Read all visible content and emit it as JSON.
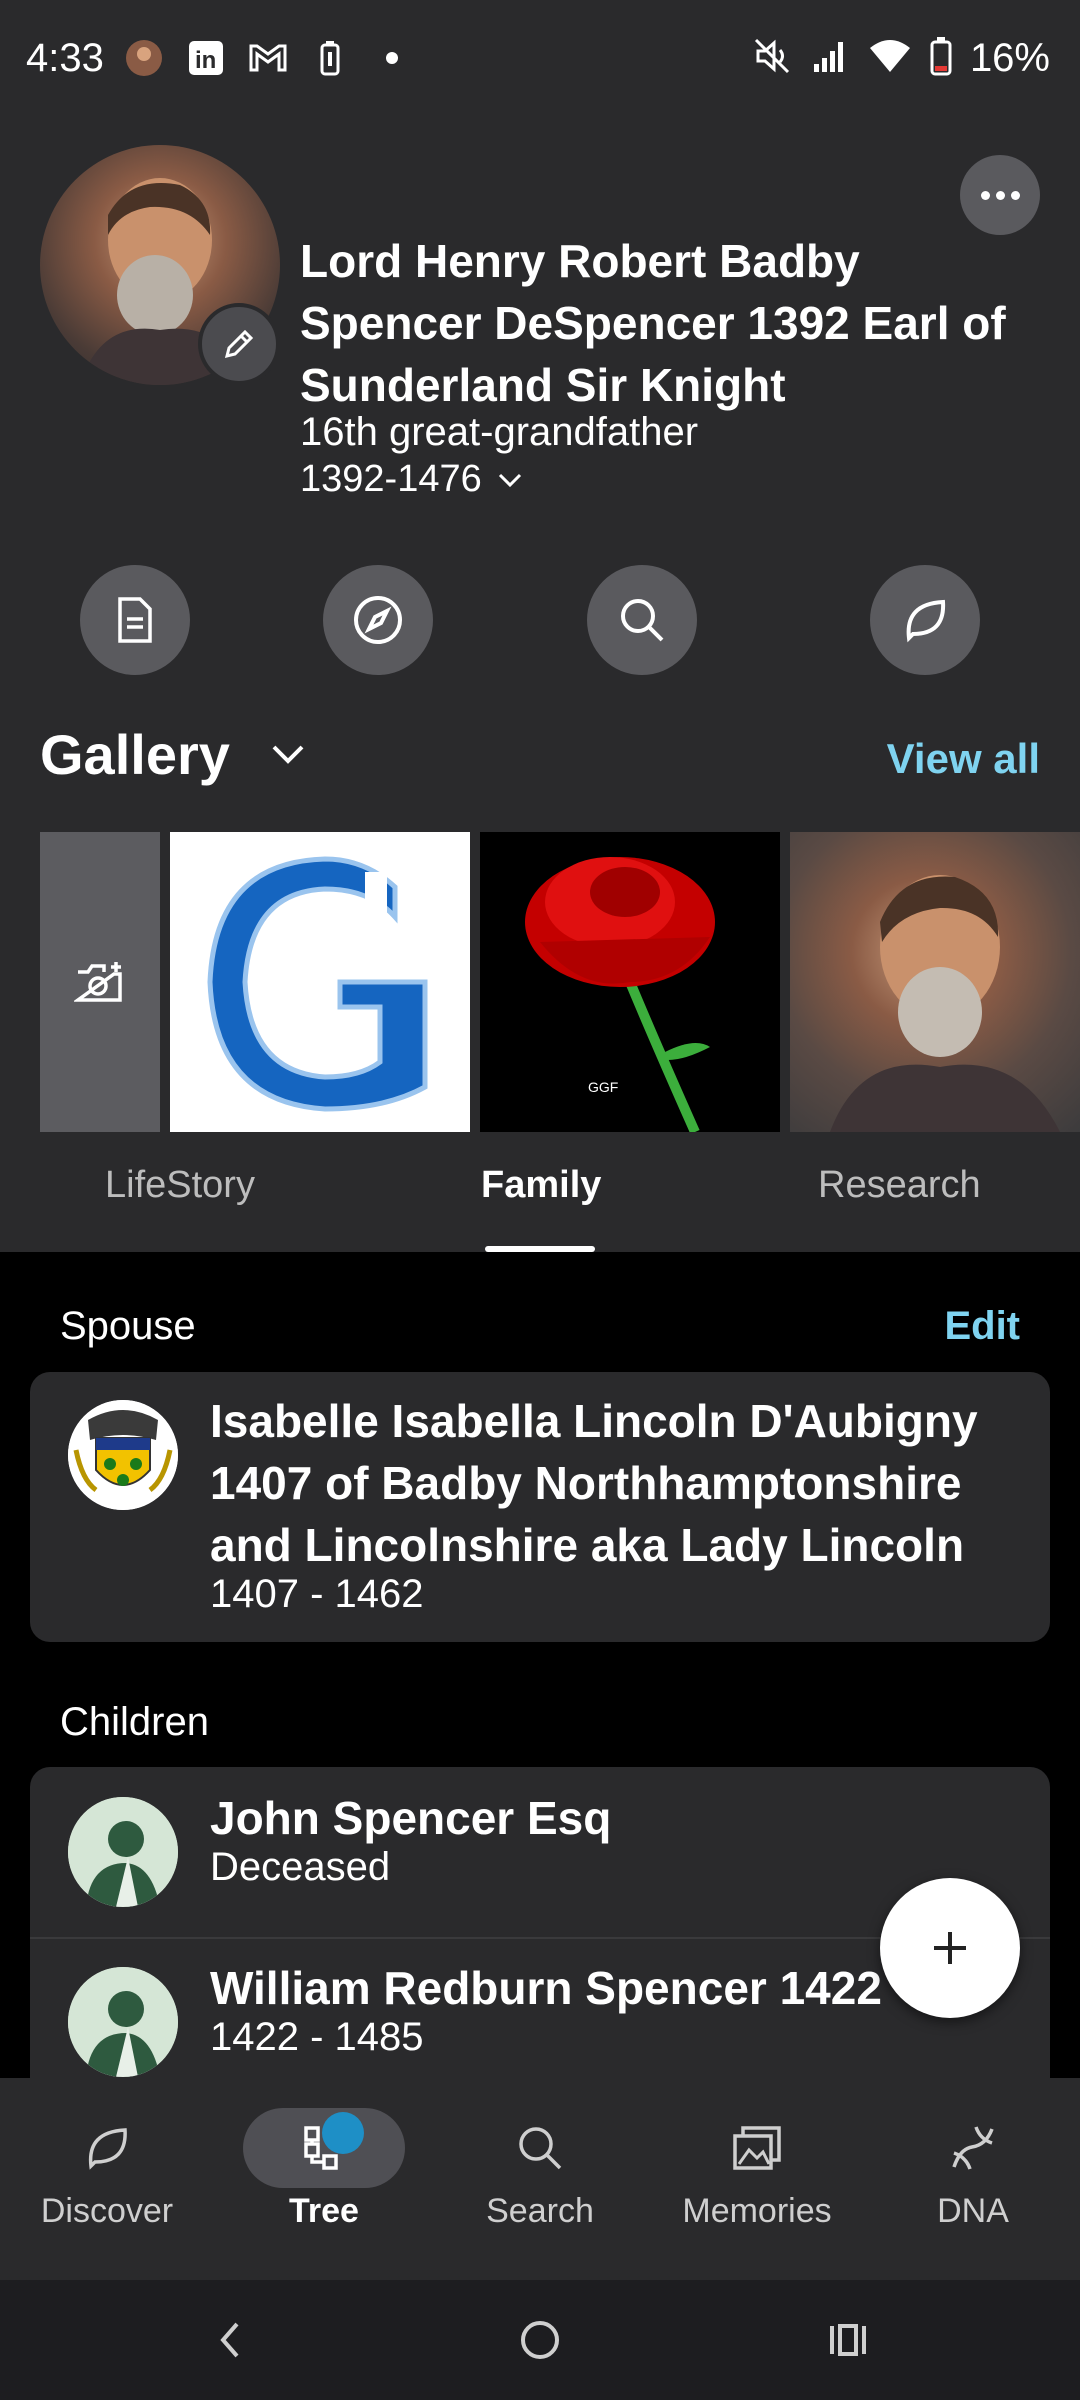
{
  "status_bar": {
    "time": "4:33",
    "battery": "16%",
    "left_icons": [
      "app-avatar-icon",
      "linkedin-icon",
      "gmail-icon",
      "battery-saver-icon",
      "dot-icon"
    ],
    "right_icons": [
      "mute-icon",
      "signal-icon",
      "wifi-icon",
      "battery-icon"
    ]
  },
  "profile": {
    "name": "Lord Henry Robert Badby Spencer DeSpencer 1392 Earl of Sunderland Sir Knight",
    "relation": "16th great-grandfather",
    "lifespan": "1392-1476"
  },
  "actions": [
    "facts-icon",
    "explore-icon",
    "search-icon",
    "discover-icon"
  ],
  "gallery": {
    "title": "Gallery",
    "view_all": "View all",
    "rose_caption": "GGF"
  },
  "tabs": [
    {
      "label": "LifeStory",
      "active": false
    },
    {
      "label": "Family",
      "active": true
    },
    {
      "label": "Research",
      "active": false
    }
  ],
  "family": {
    "spouse_label": "Spouse",
    "edit_label": "Edit",
    "spouse": {
      "name": "Isabelle Isabella Lincoln D'Aubigny 1407 of Badby Northhamptonshire and Lincolnshire aka Lady Lincoln",
      "dates": "1407 - 1462"
    },
    "children_label": "Children",
    "children": [
      {
        "name": "John Spencer Esq",
        "sub": "Deceased"
      },
      {
        "name": "William Redburn Spencer 1422",
        "sub": "1422 - 1485"
      }
    ]
  },
  "bottom_nav": [
    {
      "label": "Discover",
      "icon": "discover-icon"
    },
    {
      "label": "Tree",
      "icon": "tree-icon",
      "active": true
    },
    {
      "label": "Search",
      "icon": "search-icon"
    },
    {
      "label": "Memories",
      "icon": "memories-icon"
    },
    {
      "label": "DNA",
      "icon": "dna-icon"
    }
  ],
  "colors": {
    "accent": "#7fd3f0",
    "background": "#2a2a2c",
    "content_bg": "#000000",
    "badge": "#1e8fc6"
  }
}
